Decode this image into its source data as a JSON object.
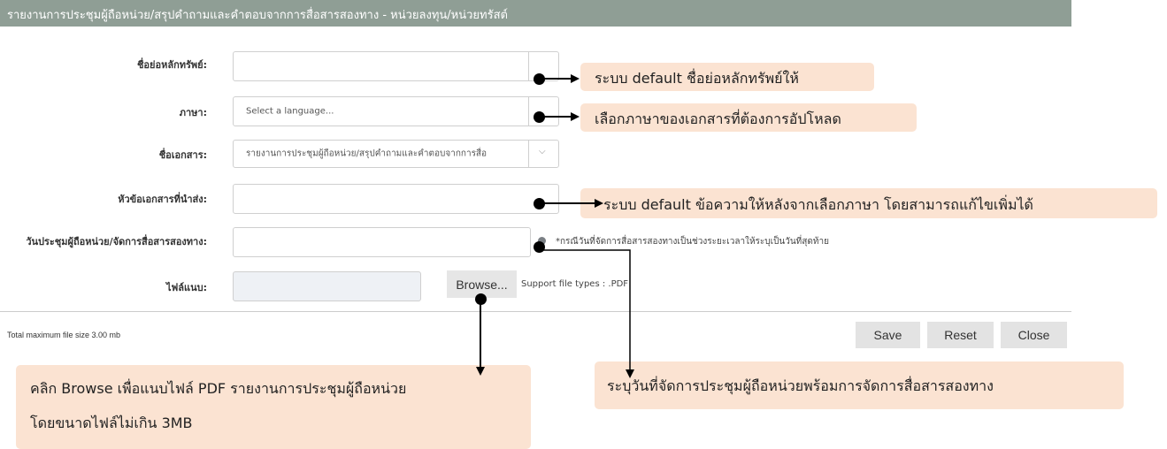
{
  "header": {
    "title": "รายงานการประชุมผู้ถือหน่วย/สรุปคำถามและคำตอบจากการสื่อสารสองทาง - หน่วยลงทุน/หน่วยทรัสต์"
  },
  "form": {
    "symbol_label": "ชื่อย่อหลักทรัพย์:",
    "symbol_value": "",
    "language_label": "ภาษา:",
    "language_placeholder": "Select a language...",
    "docname_label": "ชื่อเอกสาร:",
    "docname_value": "รายงานการประชุมผู้ถือหน่วย/สรุปคำถามและคำตอบจากการสื่อ",
    "subject_label": "หัวข้อเอกสารที่นำส่ง:",
    "subject_value": "",
    "date_label": "วันประชุมผู้ถือหน่วย/จัดการสื่อสารสองทาง:",
    "date_value": "",
    "date_note": "*กรณีวันที่จัดการสื่อสารสองทางเป็นช่วงระยะเวลาให้ระบุเป็นวันที่สุดท้าย",
    "file_label": "ไฟล์แนบ:",
    "file_value": "",
    "browse_label": "Browse...",
    "support_note": "Support file types : .PDF"
  },
  "footer": {
    "size_note": "Total maximum file size 3.00 mb",
    "save_label": "Save",
    "reset_label": "Reset",
    "close_label": "Close"
  },
  "annotations": {
    "symbol": "ระบบ default ชื่อย่อหลักทรัพย์ให้",
    "language": "เลือกภาษาของเอกสารที่ต้องการอัปโหลด",
    "subject": "ระบบ default ข้อความให้หลังจากเลือกภาษา โดยสามารถแก้ไขเพิ่มได้",
    "browse_line1": "คลิก Browse เพื่อแนบไฟล์ PDF รายงานการประชุมผู้ถือหน่วย",
    "browse_line2": "โดยขนาดไฟล์ไม่เกิน 3MB",
    "date": "ระบุวันที่จัดการประชุมผู้ถือหน่วยพร้อมการจัดการสื่อสารสองทาง"
  },
  "colors": {
    "header_bg": "#8f9e95",
    "callout_bg": "#fbe3d2",
    "button_bg": "#e3e3e3"
  }
}
